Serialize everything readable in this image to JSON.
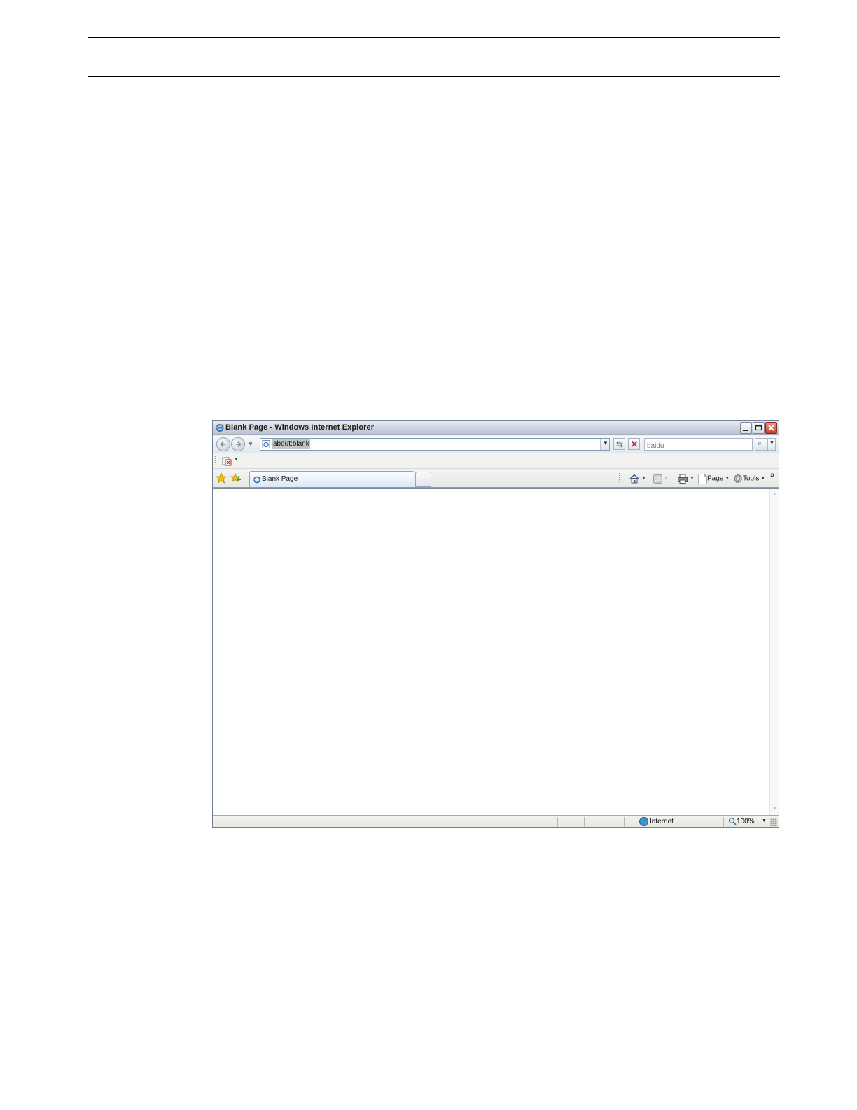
{
  "window": {
    "title": "Blank Page - Windows Internet Explorer"
  },
  "navbar": {
    "address_value": "about:blank",
    "search_placeholder": "baidu"
  },
  "tabs": [
    {
      "label": "Blank Page",
      "active": true
    }
  ],
  "command_bar": {
    "page_label": "Page",
    "tools_label": "Tools",
    "overflow": "»"
  },
  "statusbar": {
    "zone_label": "Internet",
    "zoom_label": "100%"
  },
  "icons": {
    "ie": "ie-logo-icon",
    "back": "back-arrow-icon",
    "forward": "forward-arrow-icon",
    "refresh": "refresh-icon",
    "stop": "stop-icon",
    "search": "magnifier-icon",
    "favorites": "star-icon",
    "add_favorites": "add-favorites-icon",
    "home": "home-icon",
    "feeds": "rss-icon",
    "print": "printer-icon",
    "page": "page-icon",
    "tools": "gear-icon",
    "zone": "globe-icon",
    "zoom": "zoom-icon"
  },
  "colors": {
    "close_button": "#c2412a",
    "tab_active": "#d9e8f8",
    "url_selection": "#c5c5c5"
  }
}
